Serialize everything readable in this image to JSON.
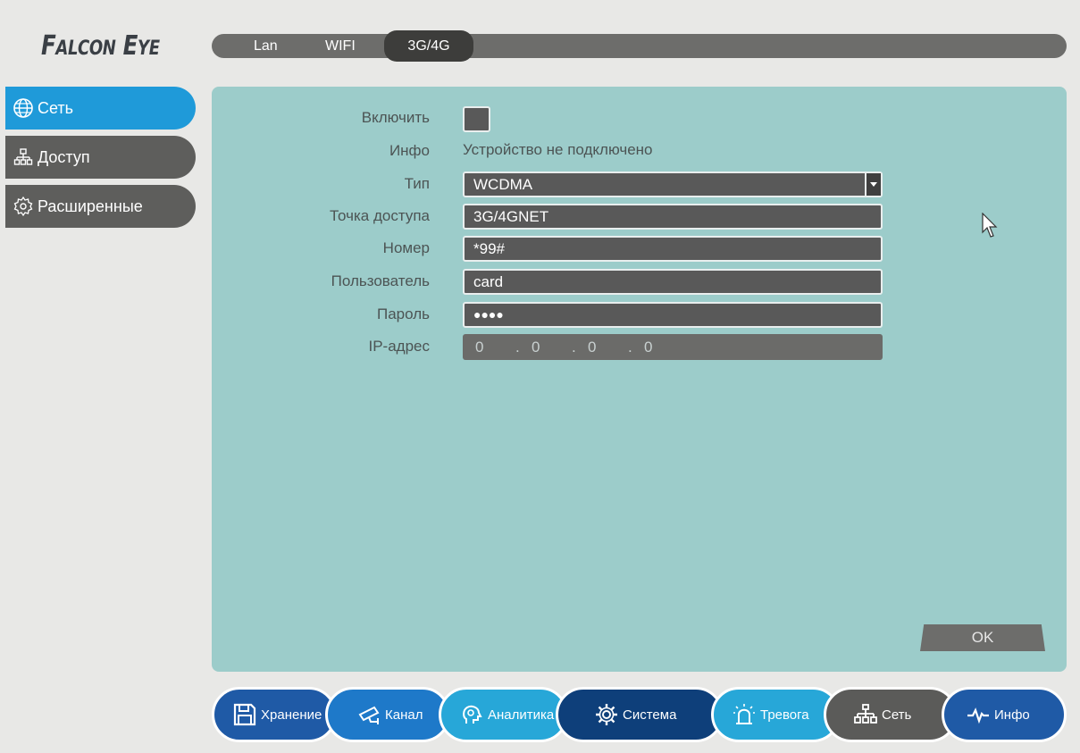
{
  "brand": {
    "first": "F",
    "first_rest": "ALCON",
    "second": "E",
    "second_rest": "YE"
  },
  "tabs": [
    {
      "label": "Lan",
      "active": false
    },
    {
      "label": "WIFI",
      "active": false
    },
    {
      "label": "3G/4G",
      "active": true
    }
  ],
  "sidebar": {
    "items": [
      {
        "label": "Сеть",
        "icon": "globe-icon",
        "active": true
      },
      {
        "label": "Доступ",
        "icon": "network-icon",
        "active": false
      },
      {
        "label": "Расширенные",
        "icon": "gear-icon",
        "active": false
      }
    ]
  },
  "form": {
    "enable_label": "Включить",
    "enable_checked": false,
    "info_label": "Инфо",
    "info_value": "Устройство не подключено",
    "type_label": "Тип",
    "type_value": "WCDMA",
    "apn_label": "Точка доступа",
    "apn_value": "3G/4GNET",
    "number_label": "Номер",
    "number_value": "*99#",
    "user_label": "Пользователь",
    "user_value": "card",
    "password_label": "Пароль",
    "password_value": "●●●●",
    "ip_label": "IP-адрес",
    "ip_octets": [
      "0",
      "0",
      "0",
      "0"
    ]
  },
  "ok_label": "OK",
  "bottom_nav": [
    {
      "label": "Хранение",
      "icon": "floppy-icon",
      "color": "#1f5aa6"
    },
    {
      "label": "Канал",
      "icon": "camera-icon",
      "color": "#1e79c9"
    },
    {
      "label": "Аналитика",
      "icon": "brain-icon",
      "color": "#27a7d8"
    },
    {
      "label": "Система",
      "icon": "gear-icon",
      "color": "#0e3f7a"
    },
    {
      "label": "Тревога",
      "icon": "alarm-icon",
      "color": "#27a7d8"
    },
    {
      "label": "Сеть",
      "icon": "network-icon",
      "color": "#5b5b59"
    },
    {
      "label": "Инфо",
      "icon": "pulse-icon",
      "color": "#1f5aa6"
    }
  ]
}
